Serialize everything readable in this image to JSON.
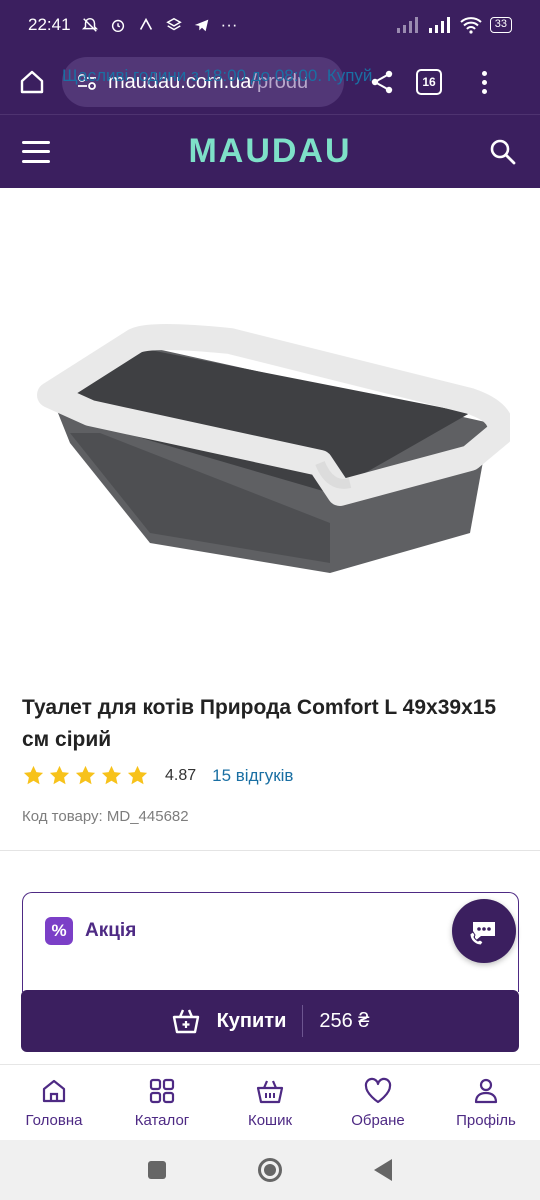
{
  "status_bar": {
    "time": "22:41",
    "more": "···",
    "battery": "33"
  },
  "browser": {
    "url_host": "maudau.com.ua",
    "url_path": "/produ",
    "tab_count": "16"
  },
  "site": {
    "logo": "MAUDAU"
  },
  "product": {
    "title": "Туалет для котів Природа Comfort L 49x39x15 см сірий",
    "rating": "4.87",
    "stars": 5,
    "reviews": "15 відгуків",
    "sku": "Код товару: MD_445682",
    "colors": {
      "star": "#f7c21b",
      "accent": "#3b1f5f",
      "link": "#1a6fa3"
    }
  },
  "promo": {
    "badge": "%",
    "title": "Акція",
    "text": "Щасливі години з 18:00 до 08:00. Купуй"
  },
  "buy": {
    "label": "Купити",
    "price": "256 ₴"
  },
  "bottom_nav": {
    "items": [
      {
        "label": "Головна",
        "icon": "home-icon"
      },
      {
        "label": "Каталог",
        "icon": "grid-icon"
      },
      {
        "label": "Кошик",
        "icon": "basket-icon"
      },
      {
        "label": "Обране",
        "icon": "heart-icon"
      },
      {
        "label": "Профіль",
        "icon": "user-icon"
      }
    ]
  }
}
